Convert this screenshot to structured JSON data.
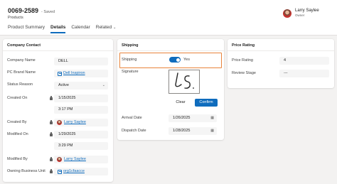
{
  "header": {
    "record_id": "0069-2589",
    "save_status": "- Saved",
    "entity_name": "Products",
    "tabs": [
      {
        "label": "Product Summary"
      },
      {
        "label": "Details"
      },
      {
        "label": "Calendar"
      },
      {
        "label": "Related"
      }
    ],
    "active_tab": "Details",
    "owner": {
      "name": "Larry Saylee",
      "role": "Owner"
    }
  },
  "company_contact": {
    "title": "Company Contact",
    "company_name": {
      "label": "Company Name",
      "value": "DELL"
    },
    "pc_brand_name": {
      "label": "PC Brand Name",
      "value": "Dell Inspiron"
    },
    "status_reason": {
      "label": "Status Reason",
      "value": "Active"
    },
    "created_on": {
      "label": "Created On",
      "date": "1/15/2025",
      "time": "3:17 PM"
    },
    "created_by": {
      "label": "Created By",
      "value": "Larry Saylee"
    },
    "modified_on": {
      "label": "Modified On",
      "date": "1/29/2025",
      "time": "3:29 PM"
    },
    "modified_by": {
      "label": "Modified By",
      "value": "Larry Saylee"
    },
    "owning_business_unit": {
      "label": "Owning Business Unit",
      "value": "org1cfaacce"
    }
  },
  "shipping": {
    "title": "Shipping",
    "shipping_toggle": {
      "label": "Shipping",
      "state_text": "Yes",
      "on": true
    },
    "signature": {
      "label": "Signature"
    },
    "clear_label": "Clear",
    "confirm_label": "Confirm",
    "arrival_date": {
      "label": "Arrival Date",
      "value": "1/26/2025"
    },
    "dispatch_date": {
      "label": "Dispatch Date",
      "value": "1/28/2025"
    }
  },
  "price_rating": {
    "title": "Price Rating",
    "price_rating": {
      "label": "Price Rating",
      "value": "4"
    },
    "review_stage": {
      "label": "Review Stage",
      "value": "---"
    }
  },
  "colors": {
    "accent": "#0f6cbd",
    "highlight": "#e8833a"
  },
  "icons": [
    "chevron-down-icon",
    "lock-icon",
    "calendar-icon",
    "record-link-icon",
    "user-avatar"
  ]
}
